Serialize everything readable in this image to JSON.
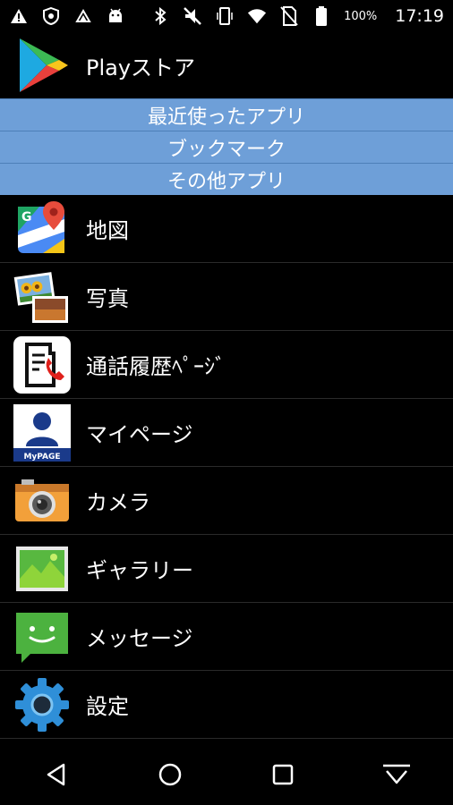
{
  "status_bar": {
    "battery": "100%",
    "time": "17:19",
    "icons_left": [
      "warning-icon",
      "shield-icon",
      "cast-icon",
      "android-icon"
    ],
    "icons_right": [
      "bluetooth-icon",
      "mute-icon",
      "vibrate-icon",
      "wifi-icon",
      "no-sim-icon",
      "battery-icon"
    ]
  },
  "header": {
    "title": "Playストア"
  },
  "tabs": [
    {
      "label": "最近使ったアプリ"
    },
    {
      "label": "ブックマーク"
    },
    {
      "label": "その他アプリ"
    }
  ],
  "apps": [
    {
      "label": "地図",
      "icon": "maps-icon"
    },
    {
      "label": "写真",
      "icon": "photos-icon"
    },
    {
      "label": "通話履歴ﾍﾟｰｼﾞ",
      "icon": "call-history-icon"
    },
    {
      "label": "マイページ",
      "icon": "mypage-icon"
    },
    {
      "label": "カメラ",
      "icon": "camera-icon"
    },
    {
      "label": "ギャラリー",
      "icon": "gallery-icon"
    },
    {
      "label": "メッセージ",
      "icon": "message-icon"
    },
    {
      "label": "設定",
      "icon": "settings-icon"
    }
  ],
  "mypage_badge": "MyPAGE",
  "colors": {
    "tab_bg": "#6e9fd8",
    "background": "#000000"
  }
}
